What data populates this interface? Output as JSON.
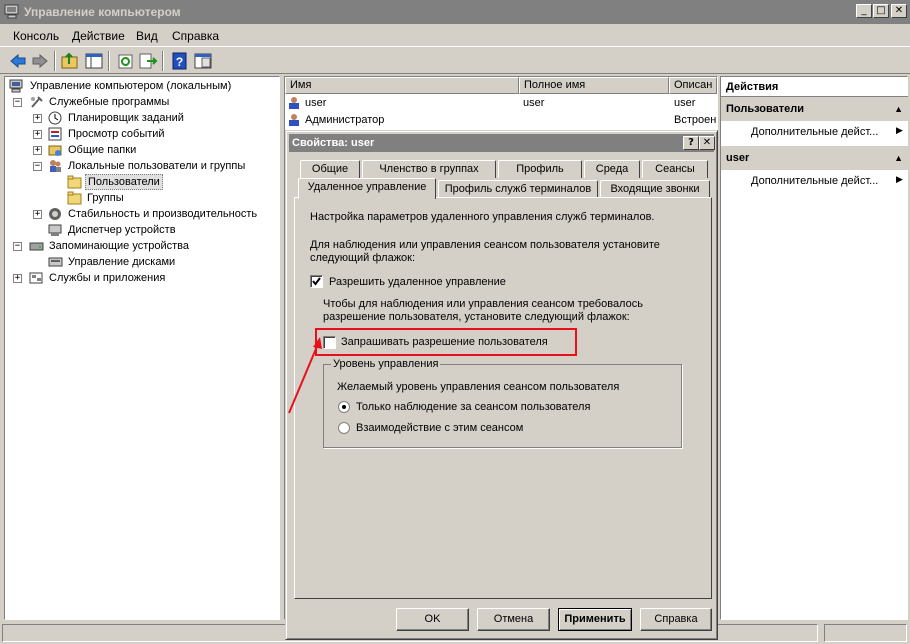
{
  "window": {
    "title": "Управление компьютером"
  },
  "menu": {
    "items": [
      "Консоль",
      "Действие",
      "Вид",
      "Справка"
    ]
  },
  "tree": {
    "root": "Управление компьютером (локальным)",
    "items": [
      "Служебные программы",
      "Планировщик заданий",
      "Просмотр событий",
      "Общие папки",
      "Локальные пользователи и группы",
      "Пользователи",
      "Группы",
      "Стабильность и производительность",
      "Диспетчер устройств",
      "Запоминающие устройства",
      "Управление дисками",
      "Службы и приложения"
    ]
  },
  "list": {
    "columns": [
      "Имя",
      "Полное имя",
      "Описан"
    ],
    "rows": [
      {
        "name": "user",
        "full": "user",
        "desc": "user"
      },
      {
        "name": "Администратор",
        "full": "",
        "desc": "Встроен"
      }
    ]
  },
  "actions": {
    "title": "Действия",
    "sections": [
      {
        "header": "Пользователи",
        "item": "Дополнительные дейст..."
      },
      {
        "header": "user",
        "item": "Дополнительные дейст..."
      }
    ]
  },
  "dialog": {
    "title": "Свойства: user",
    "tabs_row1": [
      "Общие",
      "Членство в группах",
      "Профиль",
      "Среда",
      "Сеансы"
    ],
    "tabs_row2": [
      "Удаленное управление",
      "Профиль служб терминалов",
      "Входящие звонки"
    ],
    "intro": "Настройка параметров удаленного управления служб терминалов.",
    "para1_line1": "Для наблюдения или управления сеансом пользователя установите",
    "para1_line2": "следующий флажок:",
    "enable_remote_label": "Разрешить удаленное управление",
    "enable_remote_checked": true,
    "para2_line1": "Чтобы для наблюдения или управления сеансом требовалось",
    "para2_line2": "разрешение пользователя, установите следующий флажок:",
    "require_permission_label": "Запрашивать разрешение пользователя",
    "require_permission_checked": false,
    "group_title": "Уровень управления",
    "group_desc": "Желаемый уровень управления сеансом пользователя",
    "radio1": "Только наблюдение за сеансом пользователя",
    "radio2": "Взаимодействие с этим сеансом",
    "radio_selected": 1,
    "buttons": {
      "ok": "OK",
      "cancel": "Отмена",
      "apply": "Применить",
      "help": "Справка"
    },
    "highlight_color": "#e8101c"
  }
}
